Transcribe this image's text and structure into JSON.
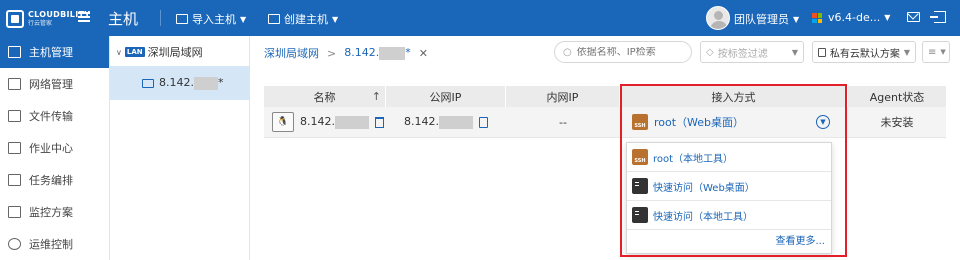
{
  "brand": {
    "line1": "CLOUDBILITY",
    "line2": "行云管家"
  },
  "topbar": {
    "title": "主机",
    "import_label": "导入主机",
    "create_label": "创建主机",
    "user_label": "团队管理员",
    "version_label": "v6.4-de...",
    "bg_color": "#1a66b8"
  },
  "sidebar": {
    "items": [
      {
        "label": "主机管理",
        "icon": "monitor-icon",
        "active": true
      },
      {
        "label": "网络管理",
        "icon": "network-icon",
        "active": false
      },
      {
        "label": "文件传输",
        "icon": "file-transfer-icon",
        "active": false
      },
      {
        "label": "作业中心",
        "icon": "job-icon",
        "active": false
      },
      {
        "label": "任务编排",
        "icon": "task-icon",
        "active": false
      },
      {
        "label": "监控方案",
        "icon": "monitor-chart-icon",
        "active": false
      },
      {
        "label": "运维控制",
        "icon": "shield-icon",
        "active": false
      }
    ]
  },
  "tree": {
    "root_badge": "LAN",
    "root_label": "深圳局域网",
    "node_prefix": "8.142.",
    "node_suffix": "*"
  },
  "breadcrumb": {
    "items": [
      "深圳局域网",
      "8.142.",
      "*"
    ],
    "separator": ">"
  },
  "filters": {
    "search_placeholder": "依据名称、IP检索",
    "tag_placeholder": "按标签过滤",
    "scheme_label": "私有云默认方案"
  },
  "table": {
    "headers": [
      "名称",
      "公网IP",
      "内网IP",
      "接入方式",
      "Agent状态"
    ],
    "sort_indicator": "↑",
    "rows": [
      {
        "name_prefix": "8.142.",
        "public_ip_prefix": "8.142.",
        "private_ip": "--",
        "access": "root（Web桌面）",
        "agent_status": "未安装"
      }
    ]
  },
  "access_dropdown": {
    "items": [
      {
        "label": "root（本地工具）",
        "icon": "ssh-icon"
      },
      {
        "label": "快速访问（Web桌面）",
        "icon": "terminal-icon"
      },
      {
        "label": "快速访问（本地工具）",
        "icon": "terminal-icon"
      }
    ],
    "more_label": "查看更多..."
  },
  "highlight_color": "#e3202a"
}
